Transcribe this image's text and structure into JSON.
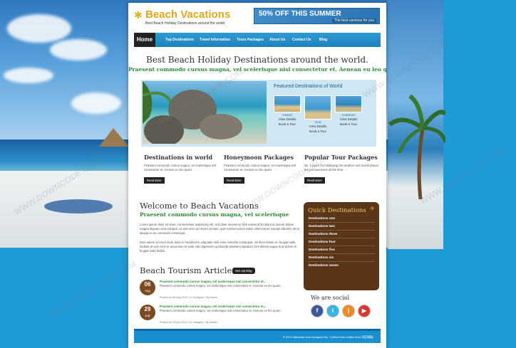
{
  "header": {
    "logo_title": "Beach Vacations",
    "logo_tagline": "Best Beach Holiday Destinations around the world",
    "banner_main": "50% OFF THIS SUMMER",
    "banner_sub": "The best services for you"
  },
  "nav": {
    "home": "Home",
    "items": [
      "Top Destinations",
      "Travel Information",
      "Tours Packages",
      "About Us",
      "Contact Us",
      "Blog"
    ]
  },
  "hero": {
    "title": "Best Beach Holiday Destinations around the world.",
    "subtitle": "Praesent commodo cursus magna, vel scelerisque nisl consectetur et. Aenean eu leo quam!"
  },
  "featured": {
    "title": "Featured Destinations of World",
    "cards": [
      {
        "name": "Hawaii",
        "link1": "View Details",
        "link2": "Book a Tour"
      },
      {
        "name": "Goa",
        "link1": "View Details",
        "link2": "Book a Tour"
      },
      {
        "name": "Andaman",
        "link1": "View Details",
        "link2": "Book a Tour"
      }
    ]
  },
  "columns": [
    {
      "title": "Destinations in world",
      "text": "Praesent commodo cursus magna, vel scelerisque nisl consectetur et. Aenean eu leo quam.",
      "button": "Read More"
    },
    {
      "title": "Honeymoon Packages",
      "text": "Praesent commodo cursus magna, vel scelerisque nisl consectetur et. Aenean eu leo quam.",
      "button": "Read More"
    },
    {
      "title": "Popular Tour Packages",
      "text": "No. 1 place for holidaying the weather and tourist places are just awesome all the time.",
      "button": "Read More"
    }
  ],
  "welcome": {
    "title": "Welcome to Beach Vacations",
    "subtitle": "Praesent commodo cursus magna, vel scelerisque",
    "para1": "Lorem ipsum dolor sit amet, consectetuer adipiscing elit, sed diam nonummy nibh euismod tincidunt ut laoreet dolore magna aliquam erat volutpat. Ut wisi enim ad minim veniam, quis nostrud exerci tation ullamcorper suscipit lobortis nisl ut aliquip ex ea commodo consequat.",
    "para2": "Duis autem vel eum iriure dolor in hendrerit in vulputate velit esse molestie consequat, vel illum dolore eu feugiat nulla facilisis at vero eros et accumsan et iusto odio dignissim qui blandit praesent luptatum zzril delenit augue duis dolore te feugait nulla facilisi."
  },
  "quick": {
    "title": "Quick Destinations",
    "items": [
      "Destinations one",
      "Destinations two",
      "Destinations three",
      "Destinations four",
      "Destinations five",
      "Destinations six",
      "Destinations seven"
    ]
  },
  "articles": {
    "title": "Beach Tourism Articles",
    "button": "See Up Blog",
    "items": [
      {
        "day": "06",
        "month": "Aug",
        "title": "Praesent commodo cursus magna, vel scelerisque nisl consectetur et...",
        "text": "Praesent commodo cursus magna, vel scelerisque nisl consectetur et. Aenean eu leo quam.",
        "meta": "Posted on 06 aug 2012 / In Category / By Admin"
      },
      {
        "day": "29",
        "month": "July",
        "title": "Praesent commodo cursus magna, vel scelerisque nisl consectetur et...",
        "text": "Praesent commodo cursus magna, vel scelerisque nisl consectetur et. Aenean eu leo quam.",
        "meta": "Posted on 29 july 2012 / In Category / By Admin"
      }
    ]
  },
  "social": {
    "title": "We are social",
    "icons": [
      {
        "name": "facebook-icon",
        "glyph": "f",
        "color": "#3b5998"
      },
      {
        "name": "twitter-icon",
        "glyph": "t",
        "color": "#33b5e5"
      },
      {
        "name": "rss-icon",
        "glyph": "r",
        "color": "#f08a24"
      },
      {
        "name": "youtube-icon",
        "glyph": "▶",
        "color": "#d93a30"
      }
    ]
  },
  "footer": {
    "text": "© 2012 sitename.com Designed By : Collect from Collect from 网页模板"
  },
  "watermark": "WWW.DOWNCODE.COM"
}
